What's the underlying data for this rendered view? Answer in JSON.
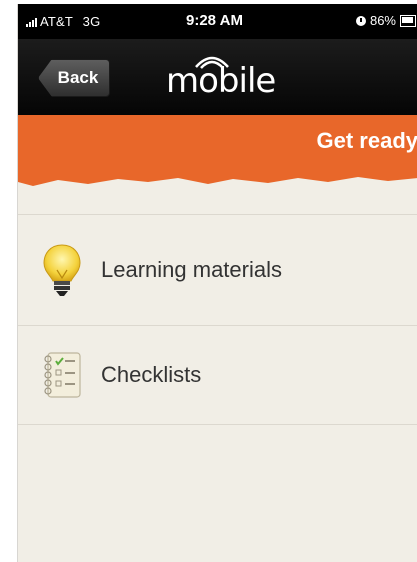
{
  "status_bar": {
    "carrier": "AT&T",
    "network": "3G",
    "time": "9:28 AM",
    "battery_level": "86%"
  },
  "nav": {
    "back_label": "Back",
    "logo_text": "mobile"
  },
  "header": {
    "title": "Get ready"
  },
  "list": {
    "items": [
      {
        "label": "Learning materials",
        "icon": "lightbulb-icon"
      },
      {
        "label": "Checklists",
        "icon": "checklist-icon"
      }
    ]
  },
  "colors": {
    "accent_orange": "#e8672a",
    "nav_background": "#0c0c0c",
    "page_background": "#f1eee6"
  }
}
